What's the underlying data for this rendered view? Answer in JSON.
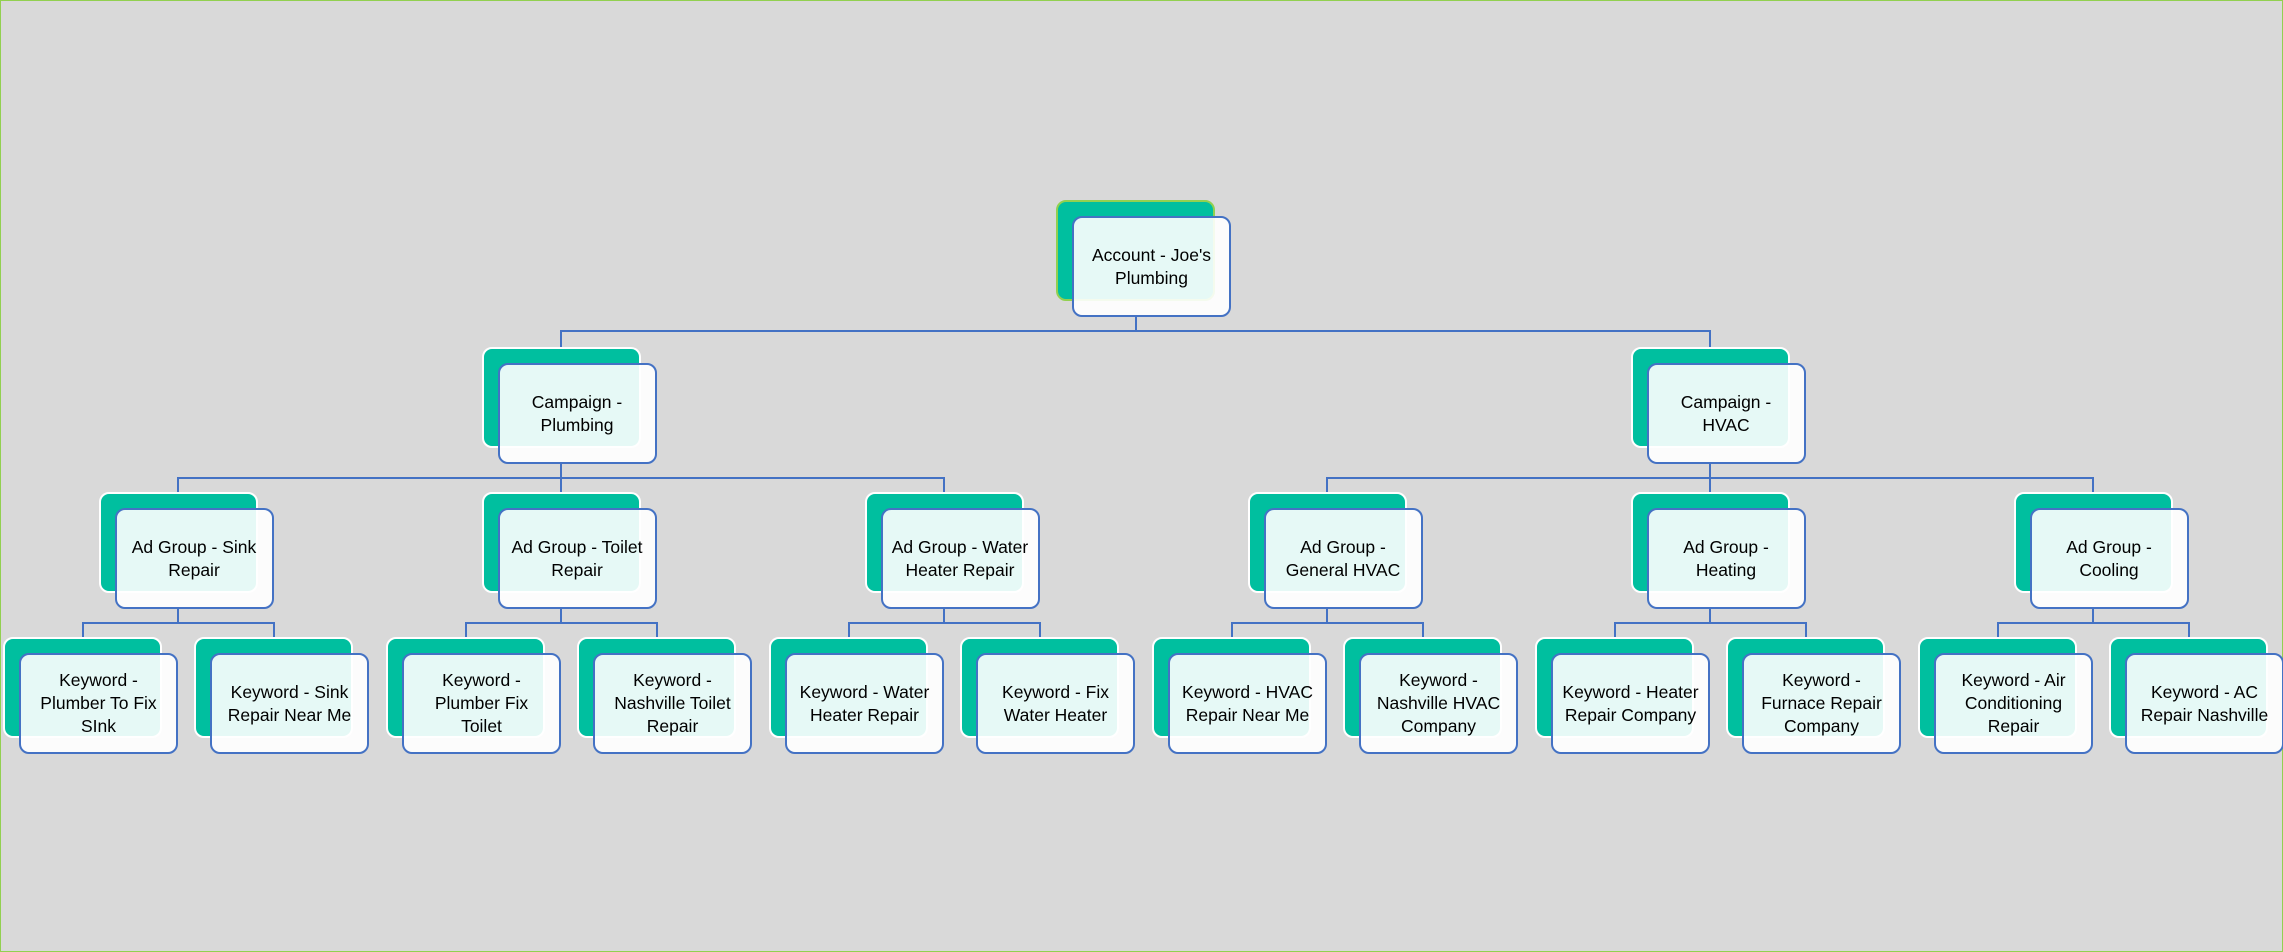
{
  "colors": {
    "background": "#d9d9d9",
    "node_back": "#00bf9f",
    "node_border": "#4472c4",
    "root_back_border": "#92d050",
    "connector": "#4472c4"
  },
  "tree": {
    "label": "Account - Joe's Plumbing",
    "children": [
      {
        "label": "Campaign - Plumbing",
        "children": [
          {
            "label": "Ad Group - Sink Repair",
            "children": [
              {
                "label": "Keyword - Plumber To Fix SInk"
              },
              {
                "label": "Keyword - Sink Repair Near Me"
              }
            ]
          },
          {
            "label": "Ad Group - Toilet Repair",
            "children": [
              {
                "label": "Keyword - Plumber Fix Toilet"
              },
              {
                "label": "Keyword - Nashville Toilet Repair"
              }
            ]
          },
          {
            "label": "Ad Group - Water Heater Repair",
            "children": [
              {
                "label": "Keyword - Water Heater Repair"
              },
              {
                "label": "Keyword - Fix Water Heater"
              }
            ]
          }
        ]
      },
      {
        "label": "Campaign - HVAC",
        "children": [
          {
            "label": "Ad Group - General HVAC",
            "children": [
              {
                "label": "Keyword - HVAC Repair Near Me"
              },
              {
                "label": "Keyword - Nashville HVAC Company"
              }
            ]
          },
          {
            "label": "Ad Group - Heating",
            "children": [
              {
                "label": "Keyword - Heater Repair Company"
              },
              {
                "label": "Keyword - Furnace Repair Company"
              }
            ]
          },
          {
            "label": "Ad Group - Cooling",
            "children": [
              {
                "label": "Keyword - Air Conditioning Repair"
              },
              {
                "label": "Keyword - AC Repair Nashville"
              }
            ]
          }
        ]
      }
    ]
  }
}
